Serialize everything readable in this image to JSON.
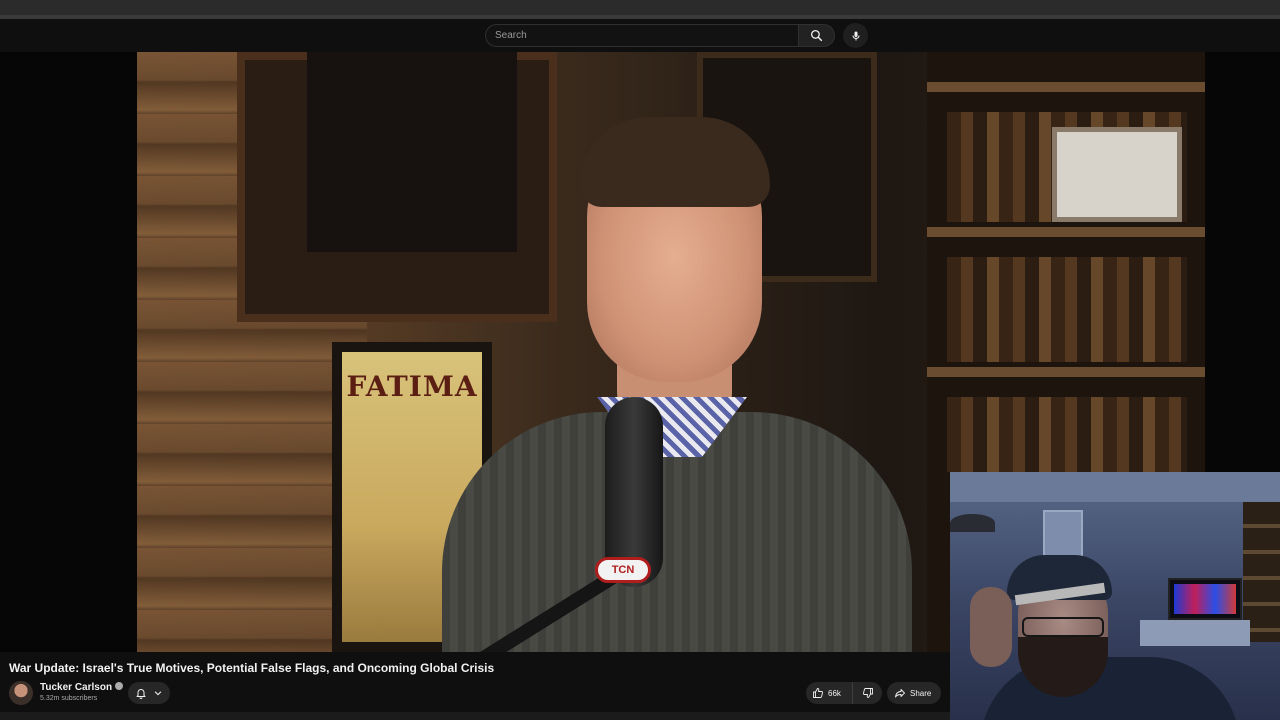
{
  "search": {
    "placeholder": "Search"
  },
  "video": {
    "title": "War Update: Israel's True Motives, Potential False Flags, and Oncoming Global Crisis",
    "poster_text": "FATIMA",
    "mic_badge": "TCN"
  },
  "channel": {
    "name": "Tucker Carlson",
    "subscribers": "5.32m subscribers"
  },
  "actions": {
    "like_count": "66k",
    "share_label": "Share"
  },
  "icons": {
    "search": "search-icon",
    "mic": "microphone-icon",
    "bell": "bell-icon",
    "chevron": "chevron-down-icon",
    "like": "thumbs-up-icon",
    "dislike": "thumbs-down-icon",
    "share": "share-arrow-icon",
    "verified": "verified-icon"
  },
  "colors": {
    "background": "#0f0f0f",
    "button": "#272727",
    "text": "#f1f1f1",
    "secondary_text": "#aaaaaa"
  }
}
